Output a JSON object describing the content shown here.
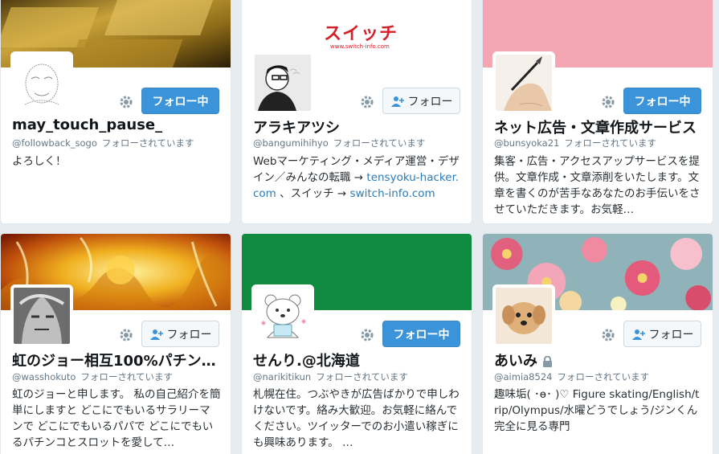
{
  "cards": [
    {
      "name": "may_touch_pause_",
      "handle": "@followback_sogo",
      "follows_you": "フォローされています",
      "button": "フォロー中",
      "bio": "よろしく！",
      "banner_color": "#8a6a1e"
    },
    {
      "name": "アラキアツシ",
      "handle": "@bangumihihyo",
      "follows_you": "フォローされています",
      "button": "フォロー",
      "bio_parts": {
        "text1": "Webマーケティング・メディア運営・デザイン／みんなの転職 → ",
        "link1": "tensyoku-hacker.com",
        "text2": " 、スイッチ → ",
        "link2": "switch-info.com"
      },
      "banner_logo": "スイッチ",
      "banner_url": "www.switch-info.com",
      "banner_color": "#ffffff"
    },
    {
      "name": "ネット広告・文章作成サービス",
      "handle": "@bunsyoka21",
      "follows_you": "フォローされています",
      "button": "フォロー中",
      "bio": "集客・広告・アクセスアップサービスを提供。文章作成・文章添削をいたします。文章を書くのが苦手なあなたのお手伝いをさせていただきます。お気軽…",
      "banner_color": "#f4a7b2"
    },
    {
      "name": "虹のジョー相互100%パチン…",
      "handle": "@wasshokuto",
      "follows_you": "フォローされています",
      "button": "フォロー",
      "bio": "虹のジョーと申します。 私の自己紹介を簡単にしますと どこにでもいるサラリーマンで どこにでもいるパパで どこにでもいるパチンコとスロットを愛して…",
      "banner_color": "#e8a317"
    },
    {
      "name": "せんり.@北海道",
      "handle": "@narikitikun",
      "follows_you": "フォローされています",
      "button": "フォロー中",
      "bio": "札幌在住。つぶやきが広告ばかりで申しわけないです。絡み大歓迎。お気軽に絡んでください。ツイッターでのお小遣い稼ぎにも興味あります。 …",
      "banner_color": "#0f8a3e"
    },
    {
      "name": "あいみ",
      "handle": "@aimia8524",
      "follows_you": "フォローされています",
      "button": "フォロー",
      "bio": "趣味垢( ･ө･ )♡ Figure skating/English/trip/Olympus/水曜どうでしょう/ジンくん 完全に見る専門",
      "banner_color": "#d9768f"
    }
  ]
}
